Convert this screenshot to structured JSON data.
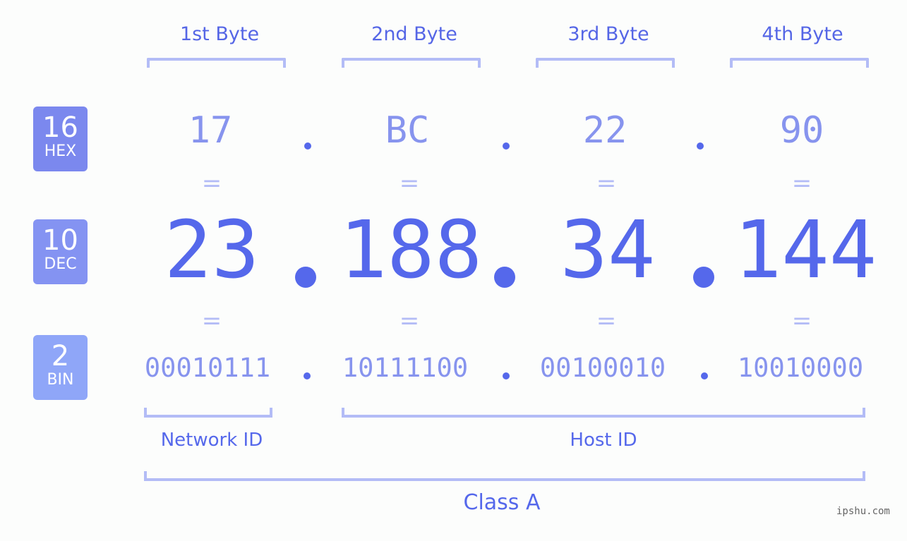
{
  "byte_headers": [
    "1st Byte",
    "2nd Byte",
    "3rd Byte",
    "4th Byte"
  ],
  "badges": {
    "hex": {
      "num": "16",
      "label": "HEX",
      "color": "#7b88ee"
    },
    "dec": {
      "num": "10",
      "label": "DEC",
      "color": "#8493f2"
    },
    "bin": {
      "num": "2",
      "label": "BIN",
      "color": "#8fa6f8"
    }
  },
  "hex_values": [
    "17",
    "BC",
    "22",
    "90"
  ],
  "dec_values": [
    "23",
    "188",
    "34",
    "144"
  ],
  "bin_values": [
    "00010111",
    "10111100",
    "00100010",
    "10010000"
  ],
  "equals_sign": "=",
  "groups": {
    "network_id": "Network ID",
    "host_id": "Host ID",
    "class": "Class A"
  },
  "watermark": "ipshu.com",
  "colors": {
    "accent": "#5568eb",
    "light_accent": "#8794ee",
    "bracket": "#b3bcf6"
  }
}
